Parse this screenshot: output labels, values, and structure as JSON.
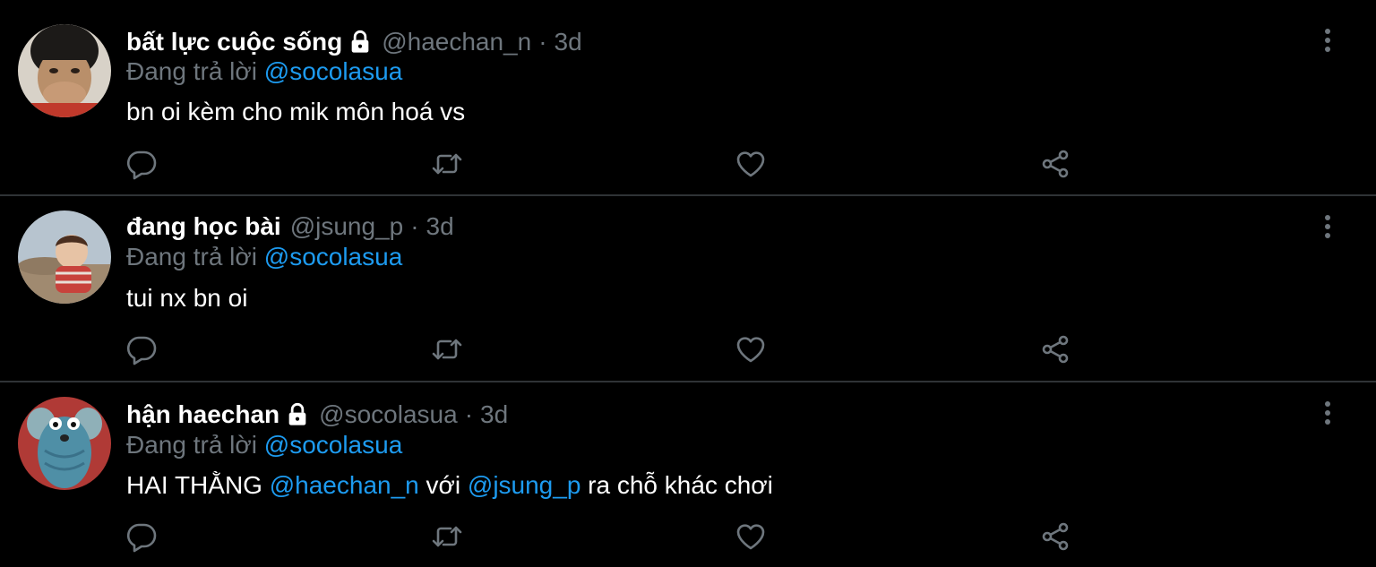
{
  "tweets": [
    {
      "display_name": "bất lực cuộc sống",
      "locked": true,
      "handle": "@haechan_n",
      "separator": "·",
      "time": "3d",
      "reply_prefix": "Đang trả lời",
      "reply_to": "@socolasua",
      "text": "bn oi kèm cho mik môn hoá vs",
      "avatar": "avatar-boy-covering-mouth"
    },
    {
      "display_name": "đang học bài",
      "locked": false,
      "handle": "@jsung_p",
      "separator": "·",
      "time": "3d",
      "reply_prefix": "Đang trả lời",
      "reply_to": "@socolasua",
      "text": "tui nx bn oi",
      "avatar": "avatar-child-outdoors"
    },
    {
      "display_name": "hận haechan",
      "locked": true,
      "handle": "@socolasua",
      "separator": "·",
      "time": "3d",
      "reply_prefix": "Đang trả lời",
      "reply_to": "@socolasua",
      "text_parts": [
        "HAI THẰNG ",
        "@haechan_n",
        " với ",
        "@jsung_p",
        " ra chỗ khác chơi"
      ],
      "avatar": "avatar-blue-mouse-toy"
    }
  ],
  "icons": {
    "reply": "speech-bubble-icon",
    "retweet": "retweet-icon",
    "like": "heart-icon",
    "share": "share-icon",
    "more": "vertical-dots-icon",
    "lock": "lock-icon"
  },
  "colors": {
    "background": "#000000",
    "text": "#ffffff",
    "secondary_text": "#6e767d",
    "mention": "#1d9bf0",
    "divider": "#2f3336"
  }
}
